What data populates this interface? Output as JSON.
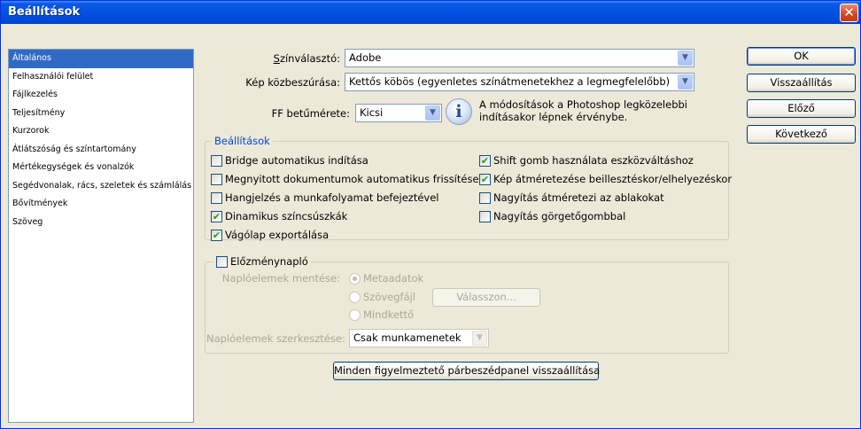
{
  "window": {
    "title": "Beállítások",
    "close_glyph": "✕"
  },
  "sidebar": {
    "items": [
      {
        "label": "Általános"
      },
      {
        "label": "Felhasználói felület"
      },
      {
        "label": "Fájlkezelés"
      },
      {
        "label": "Teljesítmény"
      },
      {
        "label": "Kurzorok"
      },
      {
        "label": "Átlátszóság és színtartomány"
      },
      {
        "label": "Mértékegységek és vonalzók"
      },
      {
        "label": "Segédvonalak, rács, szeletek és számlálás"
      },
      {
        "label": "Bővítmények"
      },
      {
        "label": "Szöveg"
      }
    ],
    "selected": "Általános"
  },
  "general": {
    "color_picker_label": "Színválasztó:",
    "color_picker_value": "Adobe",
    "interpolation_label": "Kép közbeszúrása:",
    "interpolation_value": "Kettős köbös (egyenletes színátmenetekhez a legmegfelelőbb)",
    "ui_font_size_label": "FF betűmérete:",
    "ui_font_size_value": "Kicsi",
    "info_text": "A módosítások a Photoshop legközelebbi indításakor lépnek érvénybe."
  },
  "options": {
    "group_title": "Beállítások",
    "left": [
      {
        "label": "Bridge automatikus indítása",
        "checked": false
      },
      {
        "label": "Megnyitott dokumentumok automatikus frissítése",
        "checked": false
      },
      {
        "label": "Hangjelzés a munkafolyamat befejeztével",
        "checked": false
      },
      {
        "label": "Dinamikus színcsúszkák",
        "checked": true
      },
      {
        "label": "Vágólap exportálása",
        "checked": true
      }
    ],
    "right": [
      {
        "label": "Shift gomb használata eszközváltáshoz",
        "checked": true
      },
      {
        "label": "Kép átméretezése beillesztéskor/elhelyezéskor",
        "checked": true
      },
      {
        "label": "Nagyítás átméretezi az ablakokat",
        "checked": false
      },
      {
        "label": "Nagyítás görgetőgombbal",
        "checked": false
      }
    ]
  },
  "history": {
    "title": "Előzménynapló",
    "checked": false,
    "save_label": "Naplóelemek mentése:",
    "radio_metadata": "Metaadatok",
    "radio_textfile": "Szövegfájl",
    "radio_both": "Mindkettő",
    "choose_button": "Válasszon...",
    "edit_label": "Naplóelemek szerkesztése:",
    "edit_value": "Csak munkamenetek"
  },
  "reset_warnings_button": "Minden figyelmeztető párbeszédpanel visszaállítása",
  "buttons": {
    "ok": "OK",
    "reset": "Visszaállítás",
    "prev": "Előző",
    "next": "Következő"
  },
  "colors": {
    "accent": "#316ac5",
    "group_title": "#0046d5",
    "titlebar": "#0553e4"
  },
  "icons": {
    "info": "info-icon",
    "check": "✔",
    "dropdown": "▼"
  }
}
